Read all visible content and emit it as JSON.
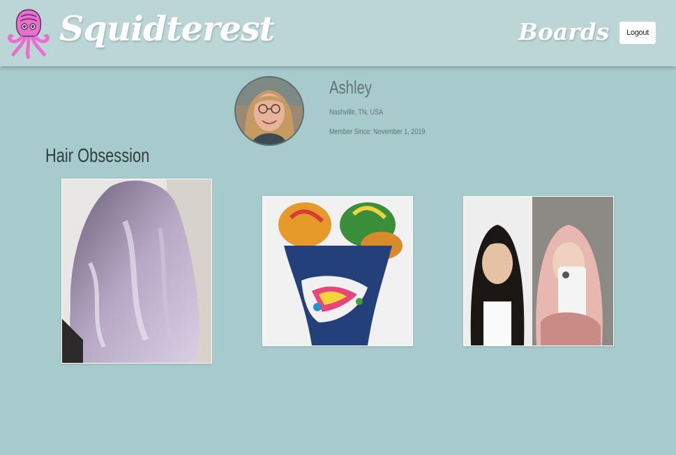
{
  "header": {
    "brand": "Squidterest",
    "logo_icon": "squid-logo-icon",
    "nav": {
      "boards_label": "Boards",
      "logout_label": "Logout"
    }
  },
  "profile": {
    "name": "Ashley",
    "location": "Nashville, TN, USA",
    "member_since": "Member Since: November 1, 2019"
  },
  "board": {
    "title": "Hair Obsession",
    "pins": [
      {
        "subject": "lavender wavy hair"
      },
      {
        "subject": "rainbow space buns with undercut design"
      },
      {
        "subject": "before and after pink hair"
      }
    ]
  },
  "colors": {
    "background": "#a7cbcd",
    "navbar": "#bcd5d6",
    "logo_pink": "#e86fcf",
    "text_muted": "#5e7476",
    "heading": "#2f3d3f"
  }
}
